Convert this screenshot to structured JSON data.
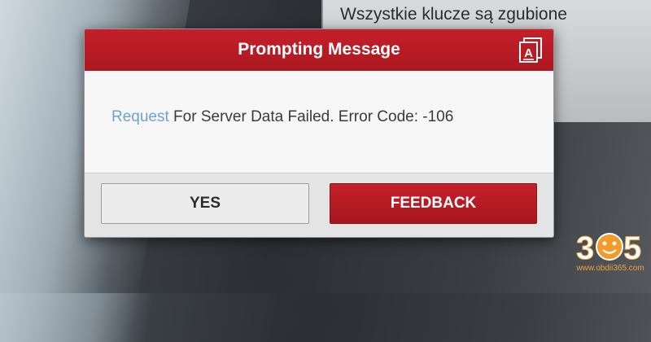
{
  "background": {
    "screen_text": "Wszystkie klucze są zgubione"
  },
  "dialog": {
    "title": "Prompting Message",
    "font_icon": "font-size-icon",
    "message_highlight": "Request",
    "message_rest": " For Server Data Failed. Error Code: -106",
    "buttons": {
      "yes": "YES",
      "feedback": "FEEDBACK"
    }
  },
  "watermark": {
    "logo_text": "365",
    "url": "www.obdii365.com"
  },
  "colors": {
    "header_red": "#c4202a",
    "button_red": "#b31b22",
    "link_blue": "#6ea3cf",
    "watermark_orange": "#f3a23b"
  }
}
